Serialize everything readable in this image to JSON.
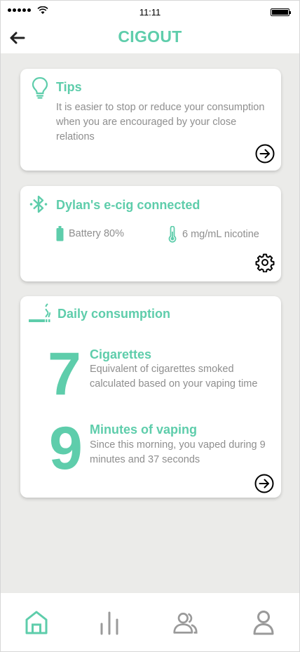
{
  "status_bar": {
    "time": "11:11"
  },
  "header": {
    "title": "CIGOUT"
  },
  "tips": {
    "title": "Tips",
    "text": "It is easier to stop or reduce your consumption when you are encouraged by your close relations"
  },
  "device": {
    "title": "Dylan's e-cig connected",
    "battery": "Battery 80%",
    "nicotine": "6 mg/mL nicotine",
    "battery_level": 0.8
  },
  "consumption": {
    "title": "Daily consumption",
    "cigarettes": {
      "value": "7",
      "label": "Cigarettes",
      "description": "Equivalent of cigarettes smoked calculated based on your vaping time"
    },
    "vaping": {
      "value": "9",
      "label": "Minutes of vaping",
      "description": "Since this morning, you vaped during 9 minutes and 37 seconds"
    }
  },
  "nav": {
    "items": [
      {
        "icon": "home-icon",
        "active": true
      },
      {
        "icon": "stats-icon",
        "active": false
      },
      {
        "icon": "community-icon",
        "active": false
      },
      {
        "icon": "profile-icon",
        "active": false
      }
    ]
  },
  "colors": {
    "accent": "#5ecdab",
    "muted_text": "#8e8e8e",
    "inactive_icon": "#9a9a9a",
    "background": "#ebebe9"
  }
}
